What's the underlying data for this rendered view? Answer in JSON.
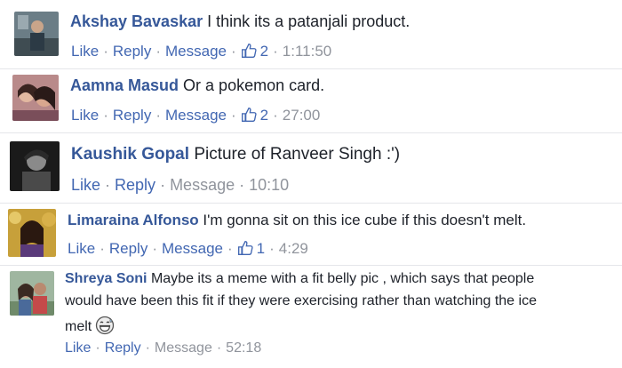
{
  "action_labels": {
    "like": "Like",
    "reply": "Reply",
    "message": "Message"
  },
  "comments": [
    {
      "author": "Akshay Bavaskar",
      "text": "I think its a patanjali product.",
      "likes": "2",
      "time": "1:11:50"
    },
    {
      "author": "Aamna Masud",
      "text": "Or a pokemon card.",
      "likes": "2",
      "time": "27:00"
    },
    {
      "author": "Kaushik Gopal",
      "text": "Picture of Ranveer Singh :')",
      "time": "10:10"
    },
    {
      "author": "Limaraina Alfonso",
      "text": "I'm gonna sit on this ice cube if this doesn't melt.",
      "likes": "1",
      "time": "4:29"
    },
    {
      "author": "Shreya Soni",
      "text": "Maybe its a meme with a fit belly pic , which says that people",
      "text_line2": "would have been this fit if they were exercising rather than watching the ice",
      "text_line3": "melt",
      "time": "52:18"
    }
  ],
  "icons": {
    "like": "thumbs-up-icon",
    "emoji": "grinning-sweat-emoji-icon"
  },
  "colors": {
    "name": "#365899",
    "link": "#4267b2",
    "muted": "#90949c",
    "text": "#1d2129"
  }
}
